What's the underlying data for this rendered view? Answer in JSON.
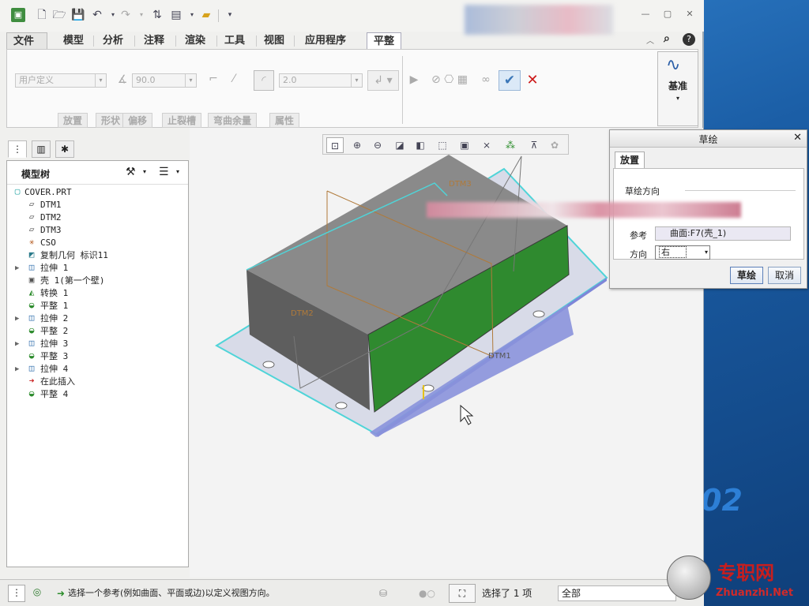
{
  "ribbon": {
    "tabs": [
      "文件",
      "模型",
      "分析",
      "注释",
      "渲染",
      "工具",
      "视图",
      "应用程序",
      "平整"
    ],
    "active_tab": "平整",
    "bend_type": "用户定义",
    "angle_value": "90.0",
    "thickness_value": "2.0",
    "group_tabs": [
      "放置",
      "形状",
      "偏移",
      "止裂槽",
      "弯曲余量",
      "属性"
    ],
    "datum_label": "基准"
  },
  "left_panel": {
    "title": "模型树",
    "tree": [
      {
        "label": "COVER.PRT",
        "icon": "part-icon",
        "expandable": false
      },
      {
        "label": "DTM1",
        "icon": "datum-plane-icon",
        "expandable": false
      },
      {
        "label": "DTM2",
        "icon": "datum-plane-icon",
        "expandable": false
      },
      {
        "label": "DTM3",
        "icon": "datum-plane-icon",
        "expandable": false
      },
      {
        "label": "CSO",
        "icon": "csys-icon",
        "expandable": false
      },
      {
        "label": "复制几何 标识11",
        "icon": "copy-geom-icon",
        "expandable": false
      },
      {
        "label": "拉伸 1",
        "icon": "extrude-icon",
        "expandable": true
      },
      {
        "label": "壳 1(第一个壁)",
        "icon": "shell-icon",
        "expandable": false
      },
      {
        "label": "转换 1",
        "icon": "convert-icon",
        "expandable": false
      },
      {
        "label": "平整 1",
        "icon": "flat-icon",
        "expandable": false
      },
      {
        "label": "拉伸 2",
        "icon": "extrude-icon",
        "expandable": true
      },
      {
        "label": "平整 2",
        "icon": "flat-icon",
        "expandable": false
      },
      {
        "label": "拉伸 3",
        "icon": "extrude-icon",
        "expandable": true
      },
      {
        "label": "平整 3",
        "icon": "flat-icon",
        "expandable": false
      },
      {
        "label": "拉伸 4",
        "icon": "extrude-icon",
        "expandable": true
      },
      {
        "label": "在此插入",
        "icon": "insert-arrow-icon",
        "expandable": false
      },
      {
        "label": "平整 4",
        "icon": "flat-new-icon",
        "expandable": false
      }
    ]
  },
  "viewport": {
    "datum_labels": [
      "DTM3",
      "DTM2",
      "DTM1"
    ]
  },
  "dialog": {
    "title": "草绘",
    "tab": "放置",
    "section": "草绘方向",
    "reference_label": "参考",
    "reference_value": "曲面:F7(壳_1)",
    "direction_label": "方向",
    "direction_value": "右",
    "ok_label": "草绘",
    "cancel_label": "取消"
  },
  "status": {
    "message": "选择一个参考(例如曲面、平面或边)以定义视图方向。",
    "selection_count": "选择了 1 项",
    "filter_value": "全部"
  },
  "desktop": {
    "background_text": "02",
    "watermark_cn": "专职网",
    "watermark_url": "Zhuanzhi.Net"
  },
  "colors": {
    "accent_green": "#2f8a2f",
    "part_gray": "#7a7a7a",
    "datum_cyan": "#4fd4d8",
    "edge_blue": "#7e86d8"
  }
}
